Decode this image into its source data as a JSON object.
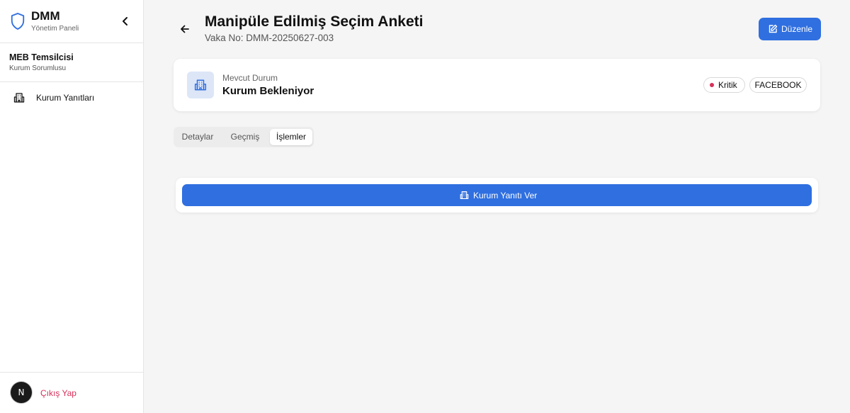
{
  "brand": {
    "title": "DMM",
    "subtitle": "Yönetim Paneli"
  },
  "user": {
    "name": "MEB Temsilcisi",
    "role": "Kurum Sorumlusu"
  },
  "sidebar": {
    "items": [
      {
        "label": "Kurum Yanıtları",
        "icon": "building-icon"
      }
    ]
  },
  "footer": {
    "avatar_initial": "N",
    "logout_label": "Çıkış Yap"
  },
  "header": {
    "title": "Manipüle Edilmiş Seçim Anketi",
    "case_no": "Vaka No: DMM-20250627-003",
    "edit_label": "Düzenle"
  },
  "status": {
    "label": "Mevcut Durum",
    "value": "Kurum Bekleniyor",
    "priority": "Kritik",
    "platform": "FACEBOOK"
  },
  "tabs": [
    {
      "label": "Detaylar"
    },
    {
      "label": "Geçmiş"
    },
    {
      "label": "İşlemler",
      "active": true
    }
  ],
  "actions": {
    "respond_label": "Kurum Yanıtı Ver"
  },
  "colors": {
    "primary": "#2f6fe0",
    "danger": "#d6305a",
    "icon_bg": "#dce6f7"
  }
}
